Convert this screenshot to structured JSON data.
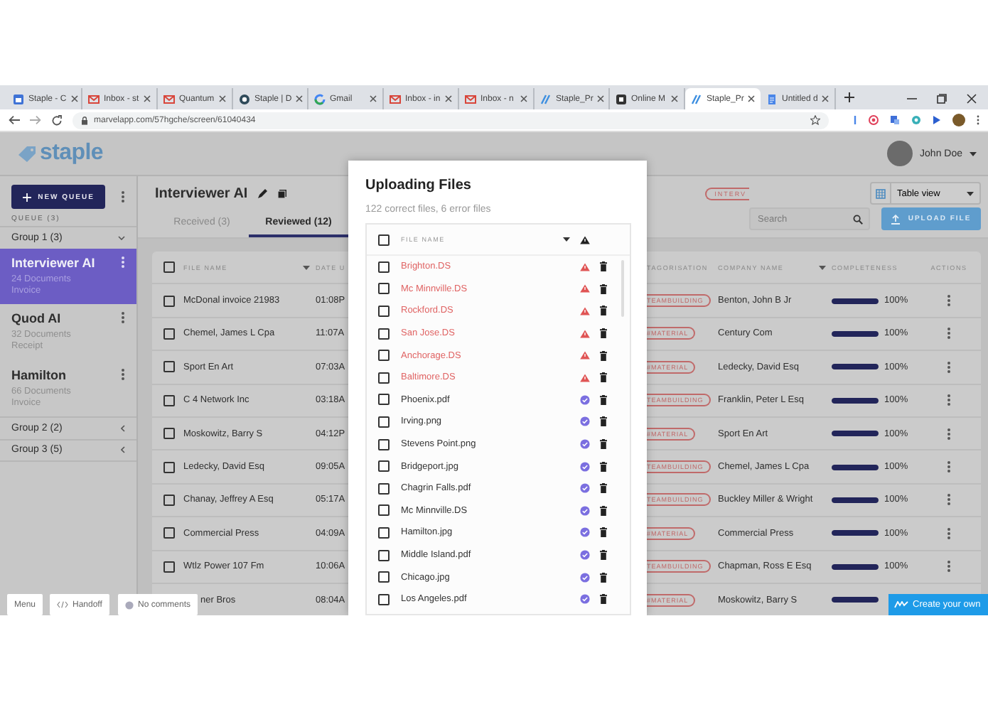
{
  "browser": {
    "tabs": [
      {
        "title": "Staple - C",
        "kind": "calendar",
        "selected": false
      },
      {
        "title": "Inbox - st",
        "kind": "mail",
        "selected": false
      },
      {
        "title": "Quantum",
        "kind": "mail",
        "selected": false
      },
      {
        "title": "Staple | D",
        "kind": "ring",
        "selected": false
      },
      {
        "title": "Gmail",
        "kind": "google",
        "selected": false
      },
      {
        "title": "Inbox - in",
        "kind": "mail",
        "selected": false
      },
      {
        "title": "Inbox - n",
        "kind": "mail",
        "selected": false
      },
      {
        "title": "Staple_Pr",
        "kind": "stripes",
        "selected": false
      },
      {
        "title": "Online M",
        "kind": "dark",
        "selected": false
      },
      {
        "title": "Staple_Pr",
        "kind": "stripes",
        "selected": true
      },
      {
        "title": "Untitled d",
        "kind": "docs",
        "selected": false
      }
    ],
    "address": "marvelapp.com/57hgche/screen/61040434"
  },
  "app": {
    "logo": "staple",
    "user": {
      "name": "John Doe"
    },
    "sidebar": {
      "new_queue": "NEW QUEUE",
      "queue_label": "QUEUE (3)",
      "groups": [
        {
          "label": "Group 1 (3)",
          "expanded": true,
          "queues": [
            {
              "name": "Interviewer AI",
              "documents": "24 Documents",
              "type": "Invoice",
              "selected": true
            },
            {
              "name": "Quod AI",
              "documents": "32 Documents",
              "type": "Receipt",
              "selected": false
            },
            {
              "name": "Hamilton",
              "documents": "66 Documents",
              "type": "Invoice",
              "selected": false
            }
          ]
        },
        {
          "label": "Group 2 (2)",
          "expanded": false
        },
        {
          "label": "Group 3 (5)",
          "expanded": false
        }
      ]
    },
    "main": {
      "title": "Interviewer AI",
      "tag": "INTERV",
      "tabs": [
        {
          "label": "Received (3)",
          "selected": false
        },
        {
          "label": "Reviewed (12)",
          "selected": true
        }
      ],
      "view": "Table view",
      "search": {
        "placeholder": "Search"
      },
      "upload": "UPLOAD FILE",
      "table": {
        "checked": false,
        "columns": [
          "FILE NAME",
          "DATE U",
          "TAGORISATION",
          "COMPANY NAME",
          "COMPLETENESS",
          "ACTIONS"
        ],
        "rows": [
          {
            "name": "McDonal invoice 21983",
            "date": "01:08P",
            "tag": "TEAMBUILDING",
            "company": "Benton, John B Jr",
            "level": 1,
            "reading": "100%",
            "checked": false
          },
          {
            "name": "Chemel, James L Cpa",
            "date": "11:07A",
            "tag": "#MATERIAL",
            "company": "Century Com",
            "level": 1,
            "reading": "100%",
            "checked": false
          },
          {
            "name": "Sport En Art",
            "date": "07:03A",
            "tag": "#MATERIAL",
            "company": "Ledecky, David Esq",
            "level": 1,
            "reading": "100%",
            "checked": false
          },
          {
            "name": "C 4 Network Inc",
            "date": "03:18A",
            "tag": "TEAMBUILDING",
            "company": "Franklin, Peter L Esq",
            "level": 1,
            "reading": "100%",
            "checked": false
          },
          {
            "name": "Moskowitz, Barry S",
            "date": "04:12P",
            "tag": "#MATERIAL",
            "company": "Sport En Art",
            "level": 1,
            "reading": "100%",
            "checked": false
          },
          {
            "name": "Ledecky, David Esq",
            "date": "09:05A",
            "tag": "TEAMBUILDING",
            "company": "Chemel, James L Cpa",
            "level": 1,
            "reading": "100%",
            "checked": false
          },
          {
            "name": "Chanay, Jeffrey A Esq",
            "date": "05:17A",
            "tag": "TEAMBUILDING",
            "company": "Buckley Miller & Wright",
            "level": 1,
            "reading": "100%",
            "checked": false
          },
          {
            "name": "Commercial Press",
            "date": "04:09A",
            "tag": "#MATERIAL",
            "company": "Commercial Press",
            "level": 1,
            "reading": "100%",
            "checked": false
          },
          {
            "name": "Wtlz Power 107 Fm",
            "date": "10:06A",
            "tag": "TEAMBUILDING",
            "company": "Chapman, Ross E Esq",
            "level": 1,
            "reading": "100%",
            "checked": false
          },
          {
            "name": "ner Bros",
            "date": "08:04A",
            "tag": "#MATERIAL",
            "company": "Moskowitz, Barry S",
            "level": 1
          }
        ]
      }
    },
    "modal": {
      "title": "Uploading Files",
      "summary": "122 correct files, 6 error files",
      "checked": false,
      "column": "FILE NAME",
      "files": [
        {
          "name": "Brighton.DS",
          "error": true,
          "checked": false
        },
        {
          "name": "Mc Minnville.DS",
          "error": true,
          "checked": false
        },
        {
          "name": "Rockford.DS",
          "error": true,
          "checked": false
        },
        {
          "name": "San Jose.DS",
          "error": true,
          "checked": false
        },
        {
          "name": "Anchorage.DS",
          "error": true,
          "checked": false
        },
        {
          "name": "Baltimore.DS",
          "error": true,
          "checked": false
        },
        {
          "name": "Phoenix.pdf",
          "error": false,
          "checked": false
        },
        {
          "name": "Irving.png",
          "error": false,
          "checked": false
        },
        {
          "name": "Stevens Point.png",
          "error": false,
          "checked": false
        },
        {
          "name": "Bridgeport.jpg",
          "error": false,
          "checked": false
        },
        {
          "name": "Chagrin Falls.pdf",
          "error": false,
          "checked": false
        },
        {
          "name": "Mc Minnville.DS",
          "error": false,
          "checked": false
        },
        {
          "name": "Hamilton.jpg",
          "error": false,
          "checked": false
        },
        {
          "name": "Middle Island.pdf",
          "error": false,
          "checked": false
        },
        {
          "name": "Chicago.jpg",
          "error": false,
          "checked": false
        },
        {
          "name": "Los Angeles.pdf",
          "error": false,
          "checked": false
        }
      ]
    }
  },
  "overlay": {
    "menu": "Menu",
    "handoff": "Handoff",
    "comments": "No comments",
    "create": "Create your own"
  }
}
